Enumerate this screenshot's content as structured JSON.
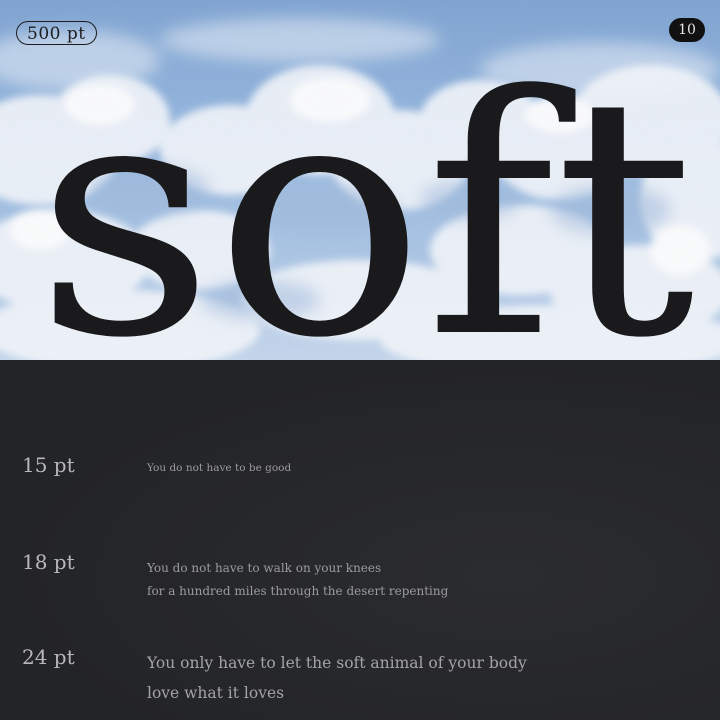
{
  "hero": {
    "word": "soft",
    "size_label": "500 pt",
    "page_number": "10"
  },
  "specimens": [
    {
      "size": "15 pt",
      "lines": [
        "You do not have to be good"
      ]
    },
    {
      "size": "18 pt",
      "lines": [
        "You do not have to walk on your knees",
        "for a hundred miles through the desert repenting"
      ]
    },
    {
      "size": "24 pt",
      "lines": [
        "You only have to let the soft animal of your body",
        "love what it loves"
      ]
    }
  ],
  "colors": {
    "sky_top": "#7ea3d2",
    "sky_bottom": "#c4d6ec",
    "panel_background": "#252527",
    "hero_text": "#1a1a1c",
    "specimen_text": "#9c9c9f",
    "size_label_text": "#b8b8ba"
  }
}
